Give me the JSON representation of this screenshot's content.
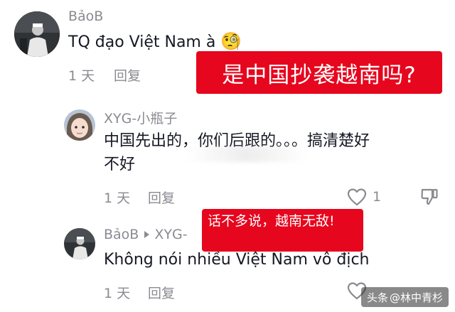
{
  "comments": [
    {
      "username": "BảoB",
      "text": "TQ đạo Việt Nam à",
      "emoji": "🧐",
      "time": "1 天",
      "reply_label": "回复"
    },
    {
      "username": "XYG-小瓶子",
      "text_line1": "中国先出的，你们后跟的。。。搞清楚好",
      "text_line2": "不好",
      "time": "1 天",
      "reply_label": "回复",
      "like_count": "1"
    },
    {
      "username": "BảoB",
      "reply_target": "XYG-",
      "text": "Không nói nhiều Việt Nam vô địch",
      "time": "1 天",
      "reply_label": "回复"
    }
  ],
  "overlays": {
    "banner_top": "是中国抄袭越南吗?",
    "banner_mid": "话不多说，越南无敌!"
  },
  "watermark": {
    "prefix": "头条",
    "handle": "@林中青杉"
  },
  "colors": {
    "banner_red": "#e6061e",
    "gray_text": "#8a8b91",
    "body_text": "#161823"
  }
}
